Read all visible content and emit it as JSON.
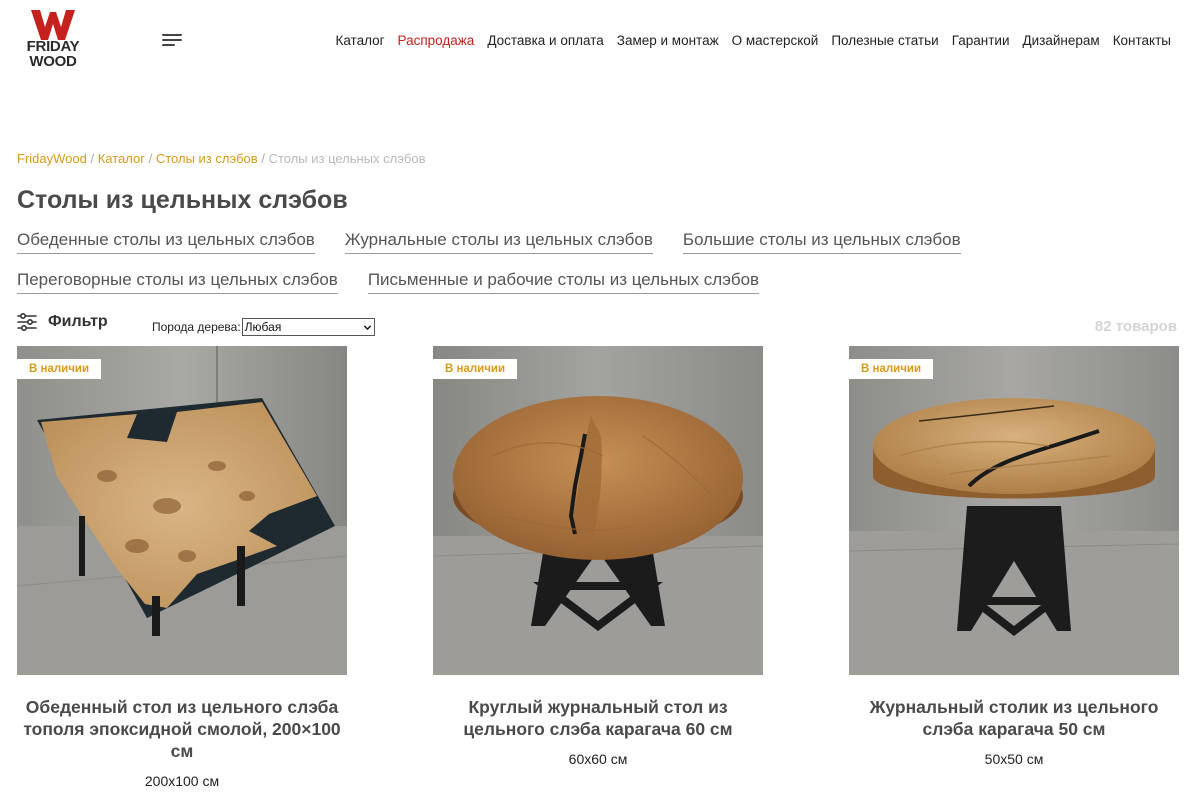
{
  "logo": {
    "letter": "W",
    "line1": "FRIDAY",
    "line2": "WOOD"
  },
  "nav": {
    "items": [
      "Каталог",
      "Распродажа",
      "Доставка и оплата",
      "Замер и монтаж",
      "О мастерской",
      "Полезные статьи",
      "Гарантии",
      "Дизайнерам",
      "Контакты"
    ],
    "sale_color": "#c5211e"
  },
  "breadcrumb": {
    "links": [
      "FridayWood",
      "Каталог",
      "Столы из слэбов"
    ],
    "separator": "/",
    "current": "Столы из цельных слэбов",
    "link_color": "#d99a1b"
  },
  "page_title": "Столы из цельных слэбов",
  "subcategories": {
    "row1": [
      "Обеденные столы из цельных слэбов",
      "Журнальные столы из цельных слэбов",
      "Большие столы из цельных слэбов"
    ],
    "row2": [
      "Переговорные столы из цельных слэбов",
      "Письменные и рабочие столы из цельных слэбов"
    ]
  },
  "filter": {
    "label": "Фильтр",
    "icon": "sliders-icon",
    "wood_label": "Порода дерева:",
    "wood_selected": "Любая"
  },
  "product_count": "82 товаров",
  "products": [
    {
      "badge": "В наличии",
      "title": "Обеденный стол из цельного слэба тополя эпоксидной смолой, 200×100 см",
      "size": "200x100 см",
      "image": "epoxy-river-dining-table"
    },
    {
      "badge": "В наличии",
      "title": "Круглый журнальный стол из цельного слэба карагача 60 см",
      "size": "60x60 см",
      "image": "round-elm-coffee-table"
    },
    {
      "badge": "В наличии",
      "title": "Журнальный столик из цельного слэба карагача 50 см",
      "size": "50x50 см",
      "image": "round-elm-side-table"
    }
  ]
}
